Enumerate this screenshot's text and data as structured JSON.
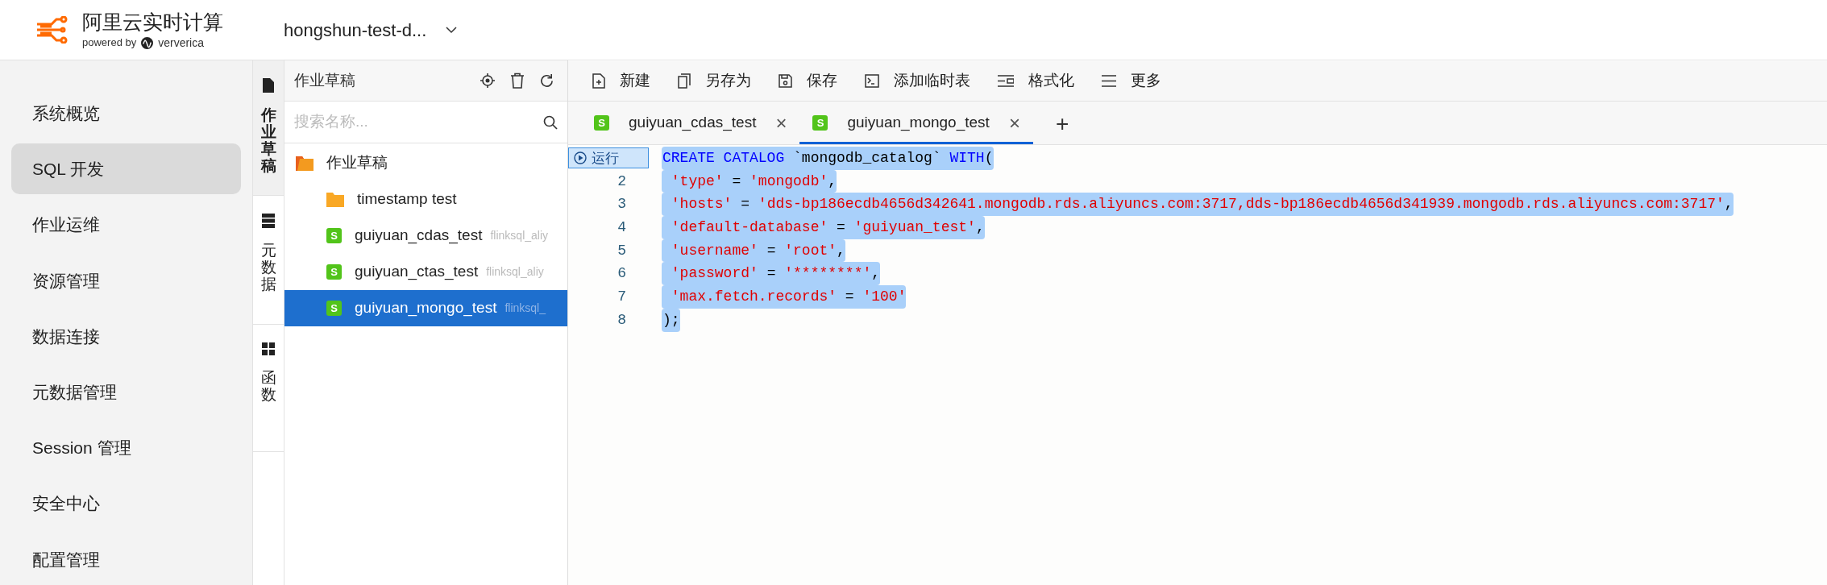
{
  "header": {
    "product_name": "阿里云实时计算",
    "powered_by": "powered by",
    "brand": "ververica",
    "workspace": "hongshun-test-d..."
  },
  "sidebar": {
    "items": [
      {
        "label": "系统概览",
        "selected": false
      },
      {
        "label": "SQL 开发",
        "selected": true
      },
      {
        "label": "作业运维",
        "selected": false
      },
      {
        "label": "资源管理",
        "selected": false
      },
      {
        "label": "数据连接",
        "selected": false
      },
      {
        "label": "元数据管理",
        "selected": false
      },
      {
        "label": "Session 管理",
        "selected": false
      },
      {
        "label": "安全中心",
        "selected": false
      },
      {
        "label": "配置管理",
        "selected": false
      }
    ]
  },
  "side_tabs": [
    {
      "label": "作业草稿",
      "selected": true
    },
    {
      "label": "元数据",
      "selected": false
    },
    {
      "label": "函数",
      "selected": false
    }
  ],
  "tree": {
    "title": "作业草稿",
    "search": {
      "placeholder": "搜索名称..."
    },
    "items": [
      {
        "label": "作业草稿",
        "kind": "folder",
        "selected": false,
        "children": [
          {
            "label": "timestamp test",
            "kind": "folder",
            "selected": false
          },
          {
            "label": "guiyuan_cdas_test",
            "kind": "file",
            "file_badge": "S",
            "meta": "flinksql_aliy",
            "selected": false
          },
          {
            "label": "guiyuan_ctas_test",
            "kind": "file",
            "file_badge": "S",
            "meta": "flinksql_aliy",
            "selected": false
          },
          {
            "label": "guiyuan_mongo_test",
            "kind": "file",
            "file_badge": "S",
            "meta": "flinksql_",
            "selected": true
          }
        ]
      }
    ]
  },
  "toolbar": [
    {
      "label": "新建"
    },
    {
      "label": "另存为"
    },
    {
      "label": "保存"
    },
    {
      "label": "添加临时表"
    },
    {
      "label": "格式化"
    },
    {
      "label": "更多"
    }
  ],
  "editor_tabs": [
    {
      "label": "guiyuan_cdas_test",
      "file_badge": "S",
      "selected": false,
      "close": "×"
    },
    {
      "label": "guiyuan_mongo_test",
      "file_badge": "S",
      "selected": true,
      "close": "×"
    }
  ],
  "add_tab": "+",
  "code": {
    "run_label": "运行",
    "lines": [
      {
        "selected": true,
        "tokens": [
          {
            "kind": "keyword",
            "text": "CREATE CATALOG"
          },
          {
            "kind": "plain",
            "text": " `mongodb_catalog` "
          },
          {
            "kind": "keyword",
            "text": "WITH"
          },
          {
            "kind": "plain",
            "text": "("
          }
        ]
      },
      {
        "number": "2",
        "selected": true,
        "tokens": [
          {
            "kind": "string",
            "text": " 'type'"
          },
          {
            "kind": "plain",
            "text": " = "
          },
          {
            "kind": "string",
            "text": "'mongodb'"
          },
          {
            "kind": "plain",
            "text": ","
          }
        ]
      },
      {
        "number": "3",
        "selected": true,
        "tokens": [
          {
            "kind": "string",
            "text": " 'hosts'"
          },
          {
            "kind": "plain",
            "text": " = "
          },
          {
            "kind": "string",
            "text": "'dds-bp186ecdb4656d342641.mongodb.rds.aliyuncs.com:3717,dds-bp186ecdb4656d341939.mongodb.rds.aliyuncs.com:3717'"
          },
          {
            "kind": "plain",
            "text": ","
          }
        ]
      },
      {
        "number": "4",
        "selected": true,
        "tokens": [
          {
            "kind": "string",
            "text": " 'default-database'"
          },
          {
            "kind": "plain",
            "text": " = "
          },
          {
            "kind": "string",
            "text": "'guiyuan_test'"
          },
          {
            "kind": "plain",
            "text": ","
          }
        ]
      },
      {
        "number": "5",
        "selected": true,
        "tokens": [
          {
            "kind": "string",
            "text": " 'username'"
          },
          {
            "kind": "plain",
            "text": " = "
          },
          {
            "kind": "string",
            "text": "'root'"
          },
          {
            "kind": "plain",
            "text": ","
          }
        ]
      },
      {
        "number": "6",
        "selected": true,
        "tokens": [
          {
            "kind": "string",
            "text": " 'password'"
          },
          {
            "kind": "plain",
            "text": " = "
          },
          {
            "kind": "string",
            "text": "'********'"
          },
          {
            "kind": "plain",
            "text": ","
          }
        ]
      },
      {
        "number": "7",
        "selected": true,
        "tokens": [
          {
            "kind": "string",
            "text": " 'max.fetch.records'"
          },
          {
            "kind": "plain",
            "text": " = "
          },
          {
            "kind": "string",
            "text": "'100'"
          }
        ]
      },
      {
        "number": "8",
        "selected": true,
        "tokens": [
          {
            "kind": "plain",
            "text": ");"
          }
        ]
      }
    ]
  }
}
